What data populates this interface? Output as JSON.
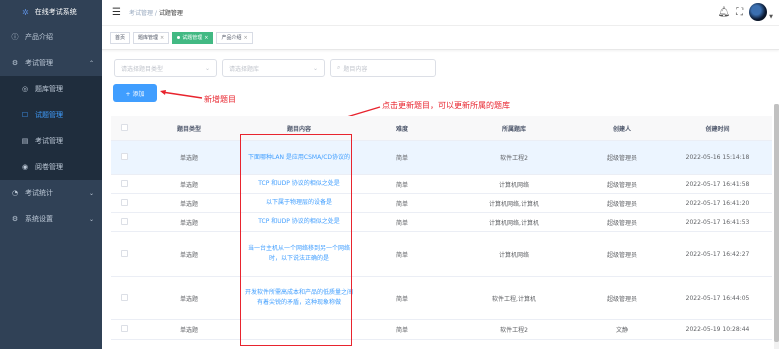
{
  "sidebar": {
    "logo": "在线考试系统",
    "items": [
      {
        "label": "产品介绍",
        "icon": "info-icon"
      },
      {
        "label": "考试管理",
        "icon": "gear-icon"
      },
      {
        "label": "题库管理",
        "icon": "grid-icon"
      },
      {
        "label": "试题管理",
        "icon": "doc-icon"
      },
      {
        "label": "考试管理",
        "icon": "doc-icon"
      },
      {
        "label": "阅卷管理",
        "icon": "eye-icon"
      },
      {
        "label": "考试统计",
        "icon": "chart-icon"
      },
      {
        "label": "系统设置",
        "icon": "gear-icon"
      }
    ]
  },
  "header": {
    "breadcrumb_root": "考试管理",
    "breadcrumb_sep": "/",
    "breadcrumb_current": "试题管理"
  },
  "tags": [
    {
      "label": "首页"
    },
    {
      "label": "题库管理"
    },
    {
      "label": "试题管理"
    },
    {
      "label": "产品介绍"
    }
  ],
  "filters": {
    "type_placeholder": "请选择题目类型",
    "bank_placeholder": "请选择题库",
    "content_placeholder": "题目内容"
  },
  "add_button": "+ 添加",
  "annotations": {
    "add": "新增题目",
    "update": "点击更新题目，可以更新所属的题库"
  },
  "table": {
    "headers": [
      "",
      "题目类型",
      "题目内容",
      "难度",
      "所属题库",
      "创建人",
      "创建时间"
    ],
    "rows": [
      {
        "type": "单选题",
        "content": "下面哪种LAN 是应用CSMA/CD协议的",
        "level": "简单",
        "bank": "软件工程2",
        "creator": "超级管理员",
        "time": "2022-05-16 15:14:18"
      },
      {
        "type": "单选题",
        "content": "TCP 和UDP 协议的相似之处是",
        "level": "简单",
        "bank": "计算机网络",
        "creator": "超级管理员",
        "time": "2022-05-17 16:41:58"
      },
      {
        "type": "单选题",
        "content": "以下属于物理层的设备是",
        "level": "简单",
        "bank": "计算机网络,计算机",
        "creator": "超级管理员",
        "time": "2022-05-17 16:41:20"
      },
      {
        "type": "单选题",
        "content": "TCP 和UDP 协议的相似之处是",
        "level": "简单",
        "bank": "计算机网络,计算机",
        "creator": "超级管理员",
        "time": "2022-05-17 16:41:53"
      },
      {
        "type": "单选题",
        "content": "当一台主机从一个网络移到另一个网络时，以下说法正确的是",
        "level": "简单",
        "bank": "计算机网络",
        "creator": "超级管理员",
        "time": "2022-05-17 16:42:27"
      },
      {
        "type": "单选题",
        "content": "开发软件所需高成本和产品的低质量之间有着尖锐的矛盾，这种现象称做",
        "level": "简单",
        "bank": "软件工程,计算机",
        "creator": "超级管理员",
        "time": "2022-05-17 16:44:05"
      },
      {
        "type": "单选题",
        "content": "",
        "level": "简单",
        "bank": "软件工程2",
        "creator": "文静",
        "time": "2022-05-19 10:28:44"
      }
    ]
  },
  "colors": {
    "sidebar_bg": "#304156",
    "accent": "#409eff",
    "tag_active": "#42b983",
    "annotation": "#e8242e"
  }
}
